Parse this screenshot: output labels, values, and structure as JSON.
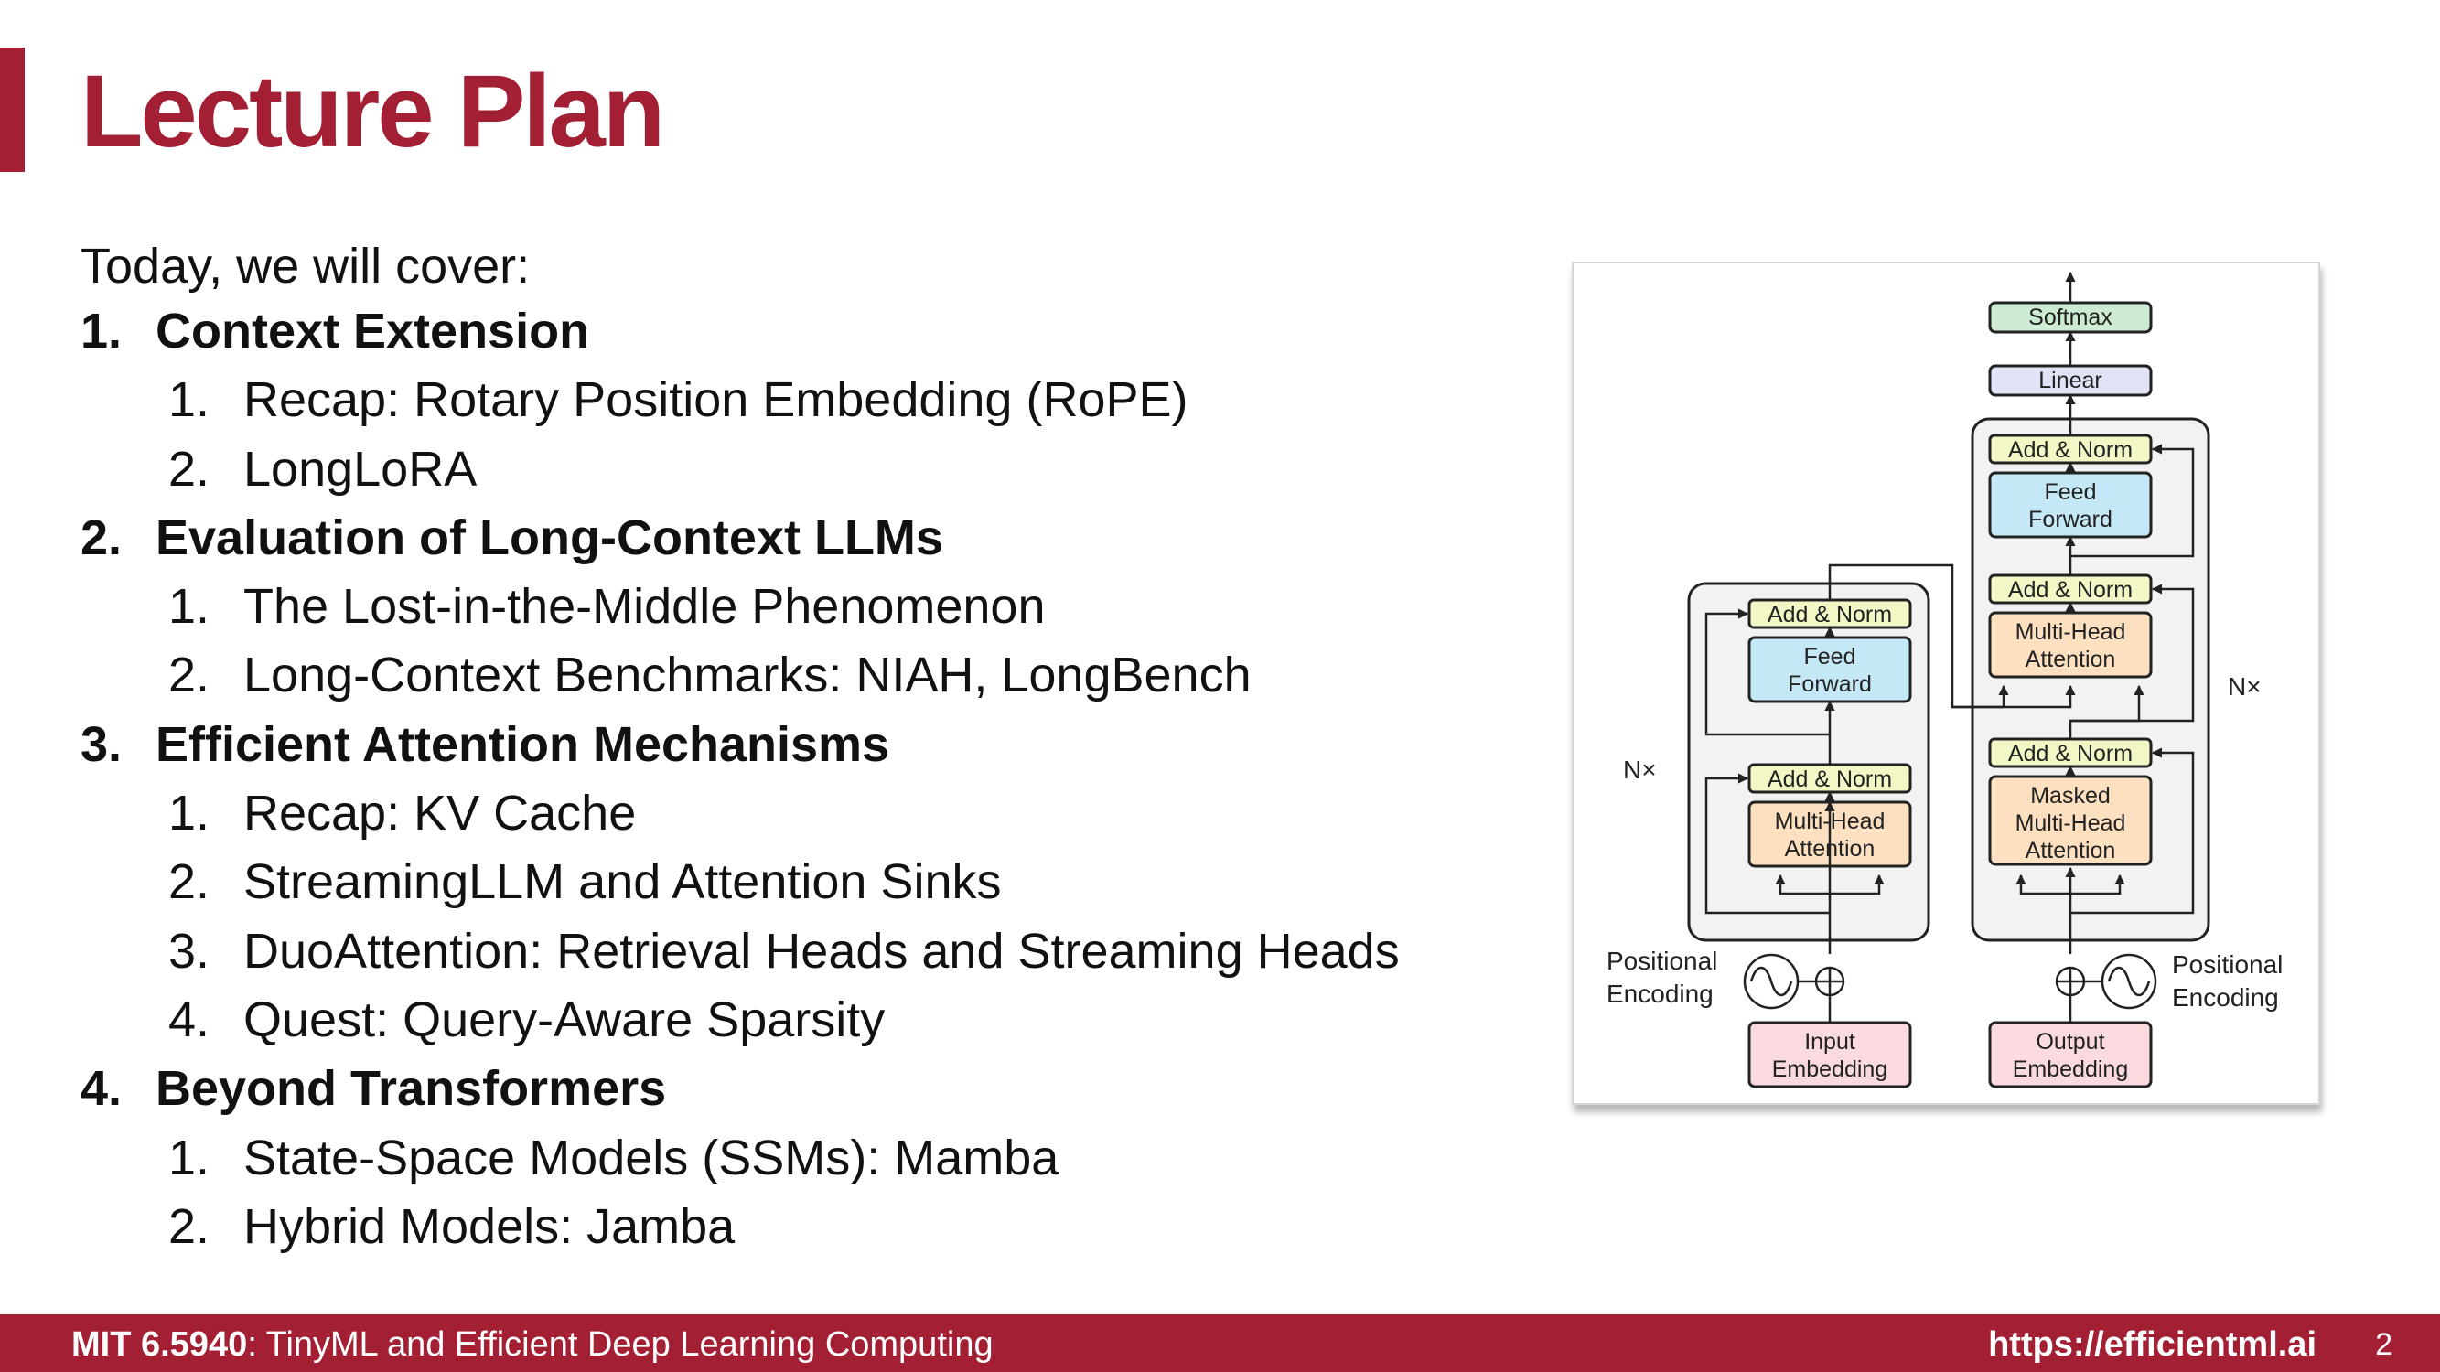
{
  "slide": {
    "title": "Lecture Plan",
    "intro": "Today, we will cover:",
    "sections": [
      {
        "num": "1.",
        "label": "Context Extension",
        "items": [
          {
            "num": "1.",
            "label": "Recap: Rotary Position Embedding (RoPE)"
          },
          {
            "num": "2.",
            "label": "LongLoRA"
          }
        ]
      },
      {
        "num": "2.",
        "label": "Evaluation of Long-Context LLMs",
        "items": [
          {
            "num": "1.",
            "label": "The Lost-in-the-Middle Phenomenon"
          },
          {
            "num": "2.",
            "label": "Long-Context Benchmarks: NIAH, LongBench"
          }
        ]
      },
      {
        "num": "3.",
        "label": "Efficient Attention Mechanisms",
        "items": [
          {
            "num": "1.",
            "label": "Recap: KV Cache"
          },
          {
            "num": "2.",
            "label": "StreamingLLM and Attention Sinks"
          },
          {
            "num": "3.",
            "label": "DuoAttention: Retrieval Heads and Streaming Heads"
          },
          {
            "num": "4.",
            "label": "Quest: Query-Aware Sparsity"
          }
        ]
      },
      {
        "num": "4.",
        "label": "Beyond Transformers",
        "items": [
          {
            "num": "1.",
            "label": "State-Space Models (SSMs): Mamba"
          },
          {
            "num": "2.",
            "label": "Hybrid Models: Jamba"
          }
        ]
      }
    ]
  },
  "diagram": {
    "softmax": "Softmax",
    "linear": "Linear",
    "add_norm": "Add & Norm",
    "feed_forward": [
      "Feed",
      "Forward"
    ],
    "multi_head_attention": [
      "Multi-Head",
      "Attention"
    ],
    "masked_multi_head_attention": [
      "Masked",
      "Multi-Head",
      "Attention"
    ],
    "nx": "N×",
    "positional_encoding": [
      "Positional",
      "Encoding"
    ],
    "input_embedding": [
      "Input",
      "Embedding"
    ],
    "output_embedding": [
      "Output",
      "Embedding"
    ],
    "colors": {
      "add_norm": "#f3f7c6",
      "feed_forward": "#c5e8f7",
      "attention": "#fce0c0",
      "embedding": "#fadade",
      "softmax": "#cdebd3",
      "linear": "#dfe3f5",
      "stack_bg": "#f2f2f2"
    }
  },
  "footer": {
    "course_code": "MIT 6.5940",
    "course_title": ": TinyML and Efficient Deep Learning Computing",
    "url": "https://efficientml.ai",
    "page": "2"
  }
}
